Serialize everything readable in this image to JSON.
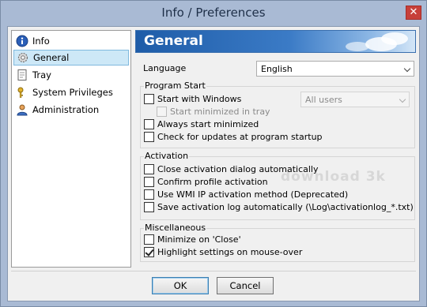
{
  "window": {
    "title": "Info / Preferences",
    "close_glyph": "✕"
  },
  "sidebar": {
    "items": [
      {
        "label": "Info",
        "icon": "info-icon"
      },
      {
        "label": "General",
        "icon": "gear-icon",
        "selected": true
      },
      {
        "label": "Tray",
        "icon": "tray-document-icon"
      },
      {
        "label": "System Privileges",
        "icon": "keys-icon"
      },
      {
        "label": "Administration",
        "icon": "admin-user-icon"
      }
    ]
  },
  "header": {
    "title": "General"
  },
  "language": {
    "label": "Language",
    "value": "English"
  },
  "program_start": {
    "title": "Program Start",
    "start_with_windows": {
      "label": "Start with Windows",
      "checked": false
    },
    "users_select": {
      "value": "All users",
      "disabled": true
    },
    "start_minimized_tray": {
      "label": "Start minimized in tray",
      "checked": false,
      "disabled": true
    },
    "always_start_minimized": {
      "label": "Always start minimized",
      "checked": false
    },
    "check_updates": {
      "label": "Check for updates at program startup",
      "checked": false
    }
  },
  "activation": {
    "title": "Activation",
    "close_dialog": {
      "label": "Close activation dialog automatically",
      "checked": false
    },
    "confirm_profile": {
      "label": "Confirm profile activation",
      "checked": false
    },
    "wmi_method": {
      "label": "Use WMI IP activation method (Deprecated)",
      "checked": false
    },
    "save_log": {
      "label": "Save activation log automatically (\\Log\\activationlog_*.txt)",
      "checked": false
    }
  },
  "misc": {
    "title": "Miscellaneous",
    "minimize_close": {
      "label": "Minimize on 'Close'",
      "checked": false
    },
    "highlight": {
      "label": "Highlight settings on mouse-over",
      "checked": true
    }
  },
  "buttons": {
    "ok": "OK",
    "cancel": "Cancel"
  },
  "watermark": "download 3k",
  "colors": {
    "header": "#2a6ab8",
    "selection": "#cde8f7",
    "window_frame": "#a9bad4"
  }
}
